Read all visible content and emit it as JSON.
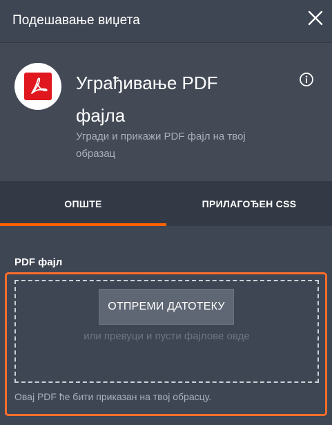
{
  "window": {
    "title": "Подешавање виџета",
    "close_icon": "close-icon"
  },
  "header": {
    "app_icon": "adobe-pdf-icon",
    "title_line1": "Уграђивање PDF",
    "title_line2": "фајла",
    "subtitle_line1": "Угради и прикажи PDF фајл на твој",
    "subtitle_line2": "образац",
    "info_icon": "info-icon"
  },
  "tabs": [
    {
      "label": "ОПШТЕ",
      "active": true
    },
    {
      "label": "ПРИЛАГОЂЕН CSS",
      "active": false
    }
  ],
  "pdf_field": {
    "label": "PDF фајл",
    "upload_button": "ОТПРЕМИ ДАТОТЕКУ",
    "drop_hint": "или превуци и пусти фајлове овде",
    "help_text": "Овај PDF ће бити приказан на твој обрасцу."
  },
  "colors": {
    "background": "#3f4653",
    "tab_bar": "#343a45",
    "accent": "#ff6100",
    "highlight": "#ff6e2c",
    "pdf_red": "#e0171e"
  }
}
